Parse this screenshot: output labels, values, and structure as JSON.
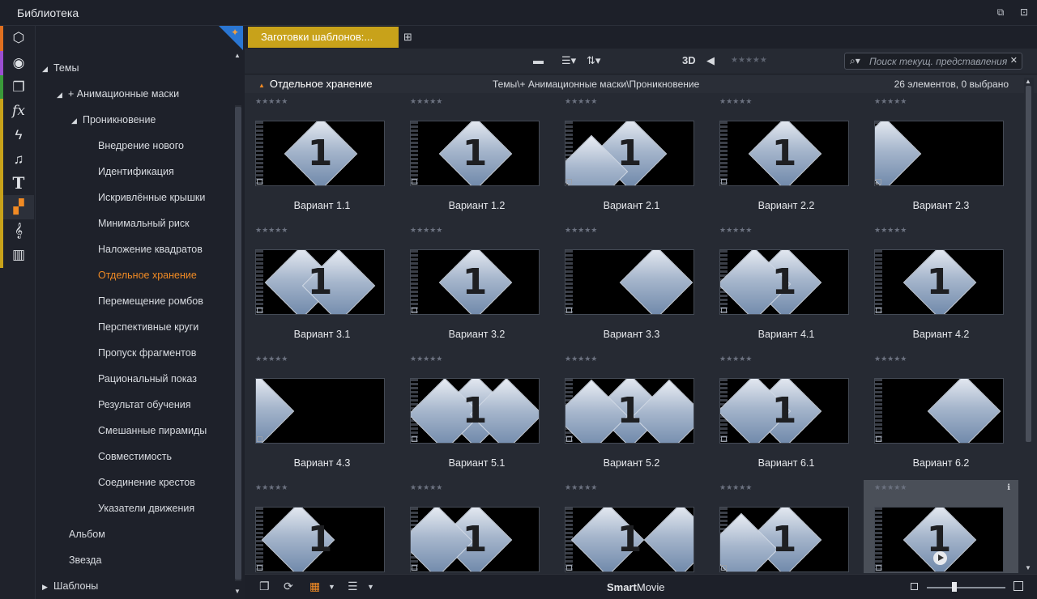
{
  "window": {
    "title": "Библиотека"
  },
  "sidebar_icons": [
    {
      "icon": "box-stack-icon",
      "glyph": "⬡",
      "color": "#e07020"
    },
    {
      "icon": "film-reel-icon",
      "glyph": "◉",
      "color": "#9b4fd0"
    },
    {
      "icon": "overlay-pages-icon",
      "glyph": "❐",
      "color": "#3a9a3a"
    },
    {
      "icon": "fx-icon",
      "glyph": "fx",
      "color": "#c8a21a"
    },
    {
      "icon": "lightning-icon",
      "glyph": "ϟ",
      "color": "#c8a21a"
    },
    {
      "icon": "music-note-icon",
      "glyph": "♫",
      "color": "#c8a21a"
    },
    {
      "icon": "title-text-icon",
      "glyph": "T",
      "color": "#c8a21a"
    },
    {
      "icon": "themes-icon",
      "glyph": "▞",
      "color": "#c8a21a"
    },
    {
      "icon": "treble-clef-icon",
      "glyph": "𝄞",
      "color": "#c8a21a"
    },
    {
      "icon": "piano-icon",
      "glyph": "▥",
      "color": "#c8a21a"
    }
  ],
  "tree": {
    "root": "Темы",
    "masks": "+ Анимационные маски",
    "penetration": "Проникновение",
    "items": [
      "Внедрение нового",
      "Идентификация",
      "Искривлённые крышки",
      "Минимальный риск",
      "Наложение квадратов",
      "Отдельное хранение",
      "Перемещение ромбов",
      "Перспективные круги",
      "Пропуск фрагментов",
      "Рациональный показ",
      "Результат обучения",
      "Смешанные пирамиды",
      "Совместимость",
      "Соединение крестов",
      "Указатели движения"
    ],
    "selected": "Отдельное хранение",
    "album": "Альбом",
    "star": "Звезда",
    "templates": "Шаблоны"
  },
  "tab": {
    "label": "Заготовки шаблонов:..."
  },
  "toolbar": {
    "label_3d": "3D",
    "search_placeholder": "Поиск текущ. представления",
    "rating": "★★★★★"
  },
  "pathbar": {
    "folder": "Отдельное хранение",
    "crumb": "Темы\\+ Анимационные маски\\Проникновение",
    "count": "26 элементов, 0 выбрано"
  },
  "thumbnails": [
    {
      "label": "Вариант 1.1",
      "number": "1"
    },
    {
      "label": "Вариант 1.2",
      "number": "1"
    },
    {
      "label": "Вариант 2.1",
      "number": "1"
    },
    {
      "label": "Вариант 2.2",
      "number": "1"
    },
    {
      "label": "Вариант 2.3",
      "number": ""
    },
    {
      "label": "Вариант 3.1",
      "number": "1"
    },
    {
      "label": "Вариант 3.2",
      "number": "1"
    },
    {
      "label": "Вариант 3.3",
      "number": ""
    },
    {
      "label": "Вариант 4.1",
      "number": "1"
    },
    {
      "label": "Вариант 4.2",
      "number": "1"
    },
    {
      "label": "Вариант 4.3",
      "number": ""
    },
    {
      "label": "Вариант 5.1",
      "number": "1"
    },
    {
      "label": "Вариант 5.2",
      "number": "1"
    },
    {
      "label": "Вариант 6.1",
      "number": "1"
    },
    {
      "label": "Вариант 6.2",
      "number": ""
    },
    {
      "label": "",
      "number": "1"
    },
    {
      "label": "",
      "number": "1"
    },
    {
      "label": "",
      "number": "1"
    },
    {
      "label": "",
      "number": "1"
    },
    {
      "label": "",
      "number": "1",
      "hover": true
    }
  ],
  "bottom": {
    "brand_bold": "Smart",
    "brand_rest": "Movie"
  },
  "colors": {
    "accent_orange": "#f08a24",
    "tab_gold": "#c8a21a",
    "pin_blue": "#2a76d2"
  }
}
